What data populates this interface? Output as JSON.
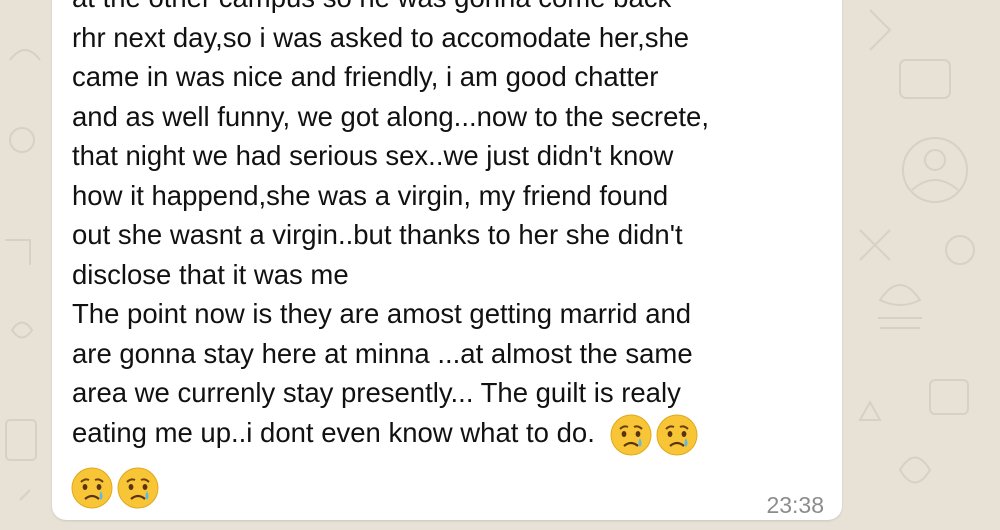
{
  "message": {
    "lines": [
      "at the other campus so he was gonna come back",
      "rhr next day,so i was asked to accomodate her,she",
      "came in was nice and friendly, i am good chatter",
      "and as well funny, we got along...now to the secrete,",
      "that night  we had serious sex..we just didn't know",
      "how it happend,she was a virgin, my friend found",
      "out she wasnt a virgin..but thanks to her she didn't",
      "disclose that it was me",
      "The point now is they are amost getting marrid and",
      "are gonna stay here at minna ...at almost the same",
      "area we currenly stay presently... The guilt is realy",
      "eating me up..i dont even know what to do."
    ],
    "emoji_name": "crying-face-emoji",
    "timestamp": "23:38"
  },
  "colors": {
    "wallpaper": "#e8e1d6",
    "bubble": "#ffffff",
    "text": "#111111",
    "timestamp": "#8c8c8c"
  }
}
